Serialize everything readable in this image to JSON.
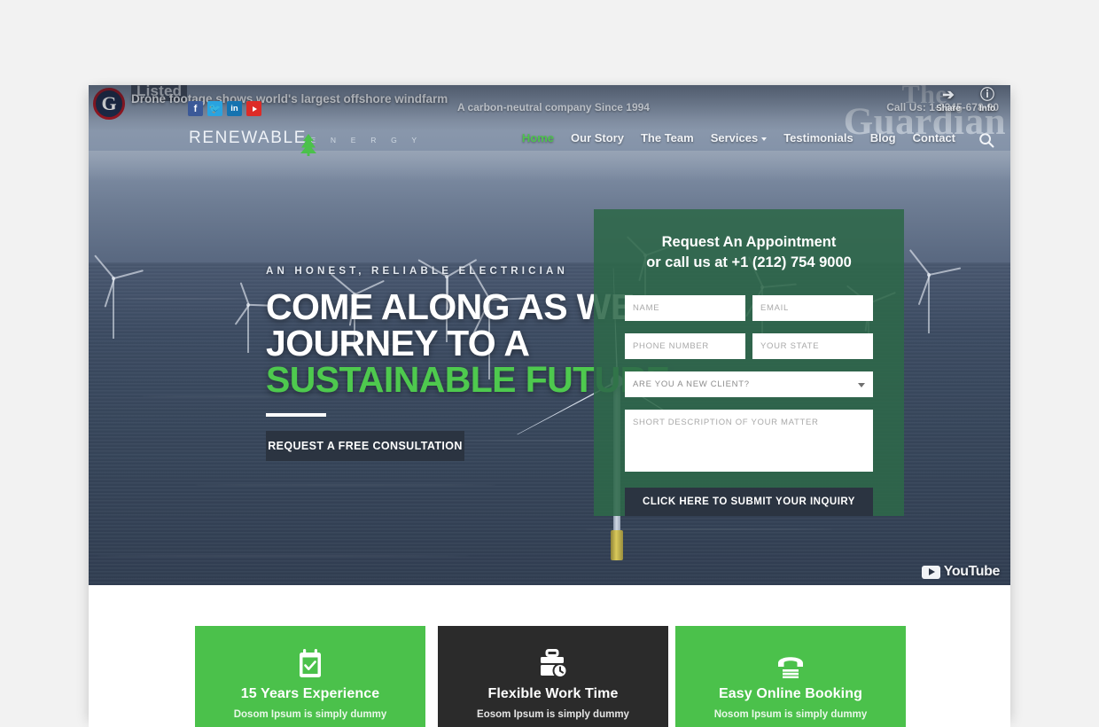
{
  "video_overlay": {
    "channel": "Listed",
    "title": "Drone footage shows world's largest offshore windfarm",
    "avatar_letter": "G",
    "watermark_line1": "The",
    "watermark_line2": "Guardian",
    "share_label": "Share",
    "info_label": "Info",
    "youtube_label": "YouTube",
    "social": [
      {
        "name": "facebook",
        "glyph": "f"
      },
      {
        "name": "twitter",
        "glyph": "ᵗ"
      },
      {
        "name": "linkedin",
        "glyph": "in"
      },
      {
        "name": "youtube",
        "glyph": ""
      }
    ]
  },
  "topbar": {
    "tagline": "A carbon-neutral company Since 1994",
    "phone": "Call Us: 1-2345-678-90"
  },
  "logo": {
    "main": "RENEWABLE",
    "sub": "E N E R G Y"
  },
  "nav": {
    "items": [
      {
        "label": "Home",
        "active": true,
        "caret": false
      },
      {
        "label": "Our Story",
        "active": false,
        "caret": false
      },
      {
        "label": "The Team",
        "active": false,
        "caret": false
      },
      {
        "label": "Services",
        "active": false,
        "caret": true
      },
      {
        "label": "Testimonials",
        "active": false,
        "caret": false
      },
      {
        "label": "Blog",
        "active": false,
        "caret": false
      },
      {
        "label": "Contact",
        "active": false,
        "caret": false
      }
    ]
  },
  "hero": {
    "eyebrow": "AN HONEST, RELIABLE ELECTRICIAN",
    "line1": "COME ALONG AS WE",
    "line2": "JOURNEY TO A",
    "line3": "SUSTAINABLE FUTURE",
    "cta": "REQUEST A FREE CONSULTATION"
  },
  "form": {
    "title_line1": "Request An Appointment",
    "title_line2": "or call us at +1 (212) 754 9000",
    "name_placeholder": "NAME",
    "email_placeholder": "EMAIL",
    "phone_placeholder": "PHONE NUMBER",
    "state_placeholder": "YOUR STATE",
    "client_select_value": "ARE YOU A NEW CLIENT?",
    "message_placeholder": "SHORT DESCRIPTION OF YOUR MATTER",
    "submit_label": "CLICK HERE TO SUBMIT YOUR INQUIRY"
  },
  "cards": [
    {
      "icon": "calendar-check-icon",
      "title": "15 Years Experience",
      "desc": "Dosom Ipsum is simply dummy"
    },
    {
      "icon": "briefcase-clock-icon",
      "title": "Flexible Work Time",
      "desc": "Eosom Ipsum is simply dummy"
    },
    {
      "icon": "telephone-icon",
      "title": "Easy Online Booking",
      "desc": "Nosom Ipsum is simply dummy"
    }
  ],
  "colors": {
    "accent_green": "#4bc14b",
    "hero_green": "#4ec94e",
    "panel_green": "#2e6849",
    "dark": "#2b3441",
    "card_dark": "#2b2b2b"
  }
}
